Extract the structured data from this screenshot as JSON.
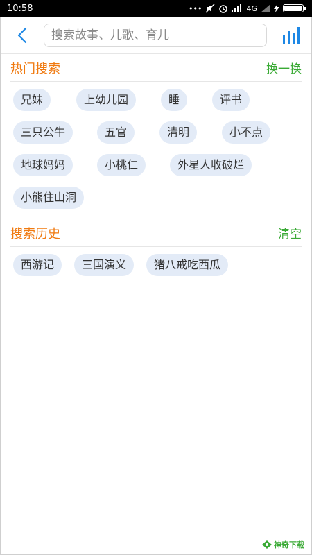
{
  "status": {
    "time": "10:58",
    "network": "4G",
    "battery_level": 0.95
  },
  "header": {
    "search_placeholder": "搜索故事、儿歌、育儿"
  },
  "hot": {
    "title": "热门搜索",
    "action": "换一换",
    "rows": [
      [
        "兄妹",
        "上幼儿园",
        "睡",
        "评书"
      ],
      [
        "三只公牛",
        "五官",
        "清明",
        "小不点"
      ],
      [
        "地球妈妈",
        "小桃仁",
        "外星人收破烂"
      ],
      [
        "小熊住山洞"
      ]
    ]
  },
  "history": {
    "title": "搜索历史",
    "action": "清空",
    "items": [
      "西游记",
      "三国演义",
      "猪八戒吃西瓜"
    ]
  },
  "watermark": "神奇下载",
  "colors": {
    "accent_orange": "#f07a10",
    "accent_green": "#3aaa35",
    "icon_blue": "#1e88e5",
    "chip_bg": "#e3ebf7"
  }
}
